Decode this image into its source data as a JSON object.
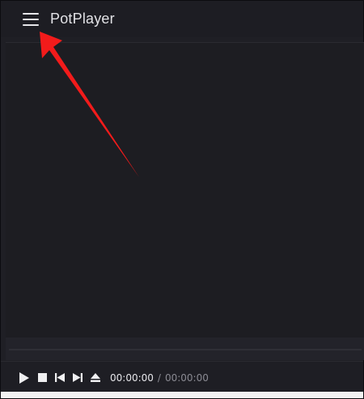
{
  "window": {
    "title": "PotPlayer"
  },
  "playback": {
    "current_time": "00:00:00",
    "separator": "/",
    "total_time": "00:00:00",
    "progress": 0
  },
  "icons": {
    "menu": "hamburger-menu-icon",
    "play": "play-icon",
    "stop": "stop-icon",
    "previous": "skip-previous-icon",
    "next": "skip-next-icon",
    "eject": "eject-icon"
  },
  "colors": {
    "background": "#1f1f25",
    "text": "#e2e2e6",
    "muted_text": "#8a8a92",
    "annotation_arrow": "#f21b1b"
  }
}
